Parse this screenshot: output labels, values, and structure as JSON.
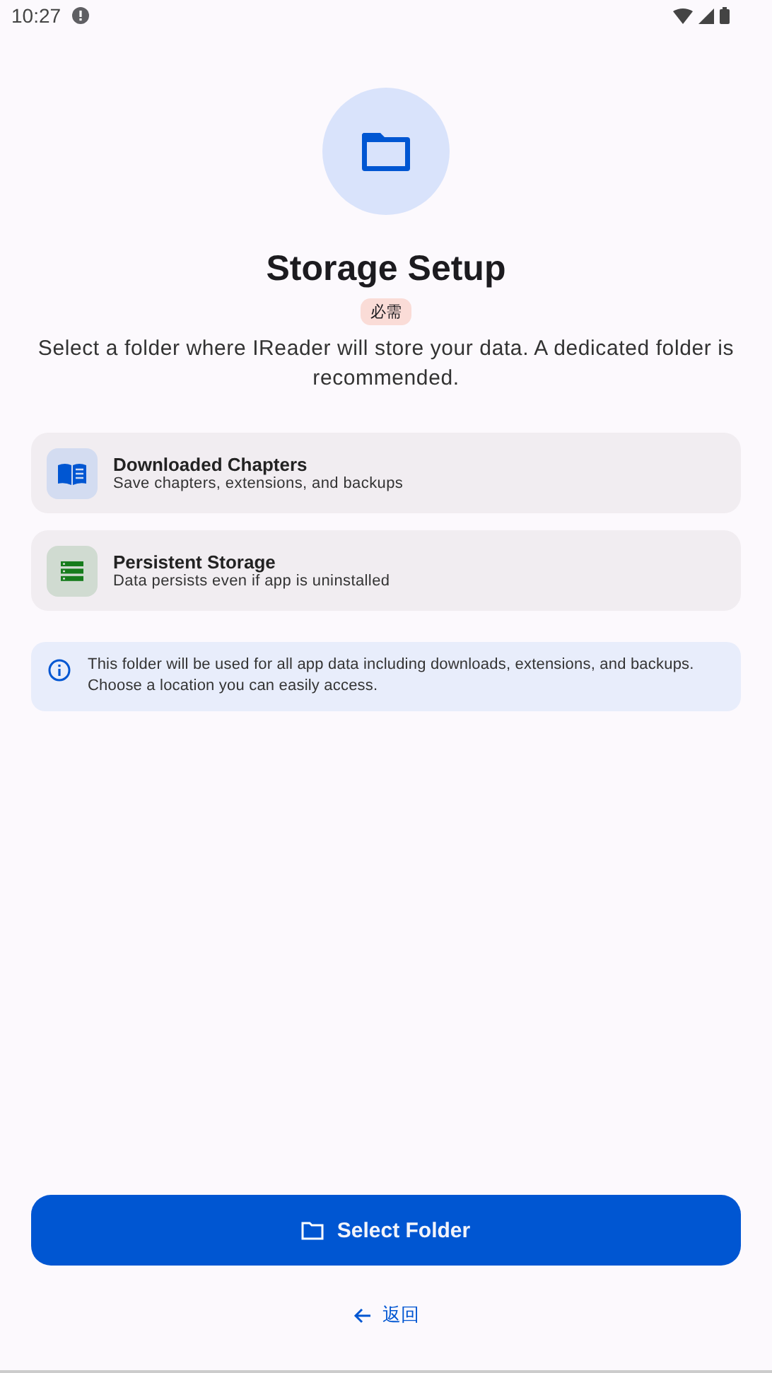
{
  "status_bar": {
    "time": "10:27"
  },
  "title": "Storage Setup",
  "badge": "必需",
  "description": "Select a folder where IReader will store your data. A dedicated folder is recommended.",
  "features": [
    {
      "kind": "book",
      "title": "Downloaded Chapters",
      "subtitle": "Save chapters, extensions, and backups"
    },
    {
      "kind": "storage",
      "title": "Persistent Storage",
      "subtitle": "Data persists even if app is uninstalled"
    }
  ],
  "info": "This folder will be used for all app data including downloads, extensions, and backups. Choose a location you can easily access.",
  "primary_button": "Select Folder",
  "back_link": "返回"
}
